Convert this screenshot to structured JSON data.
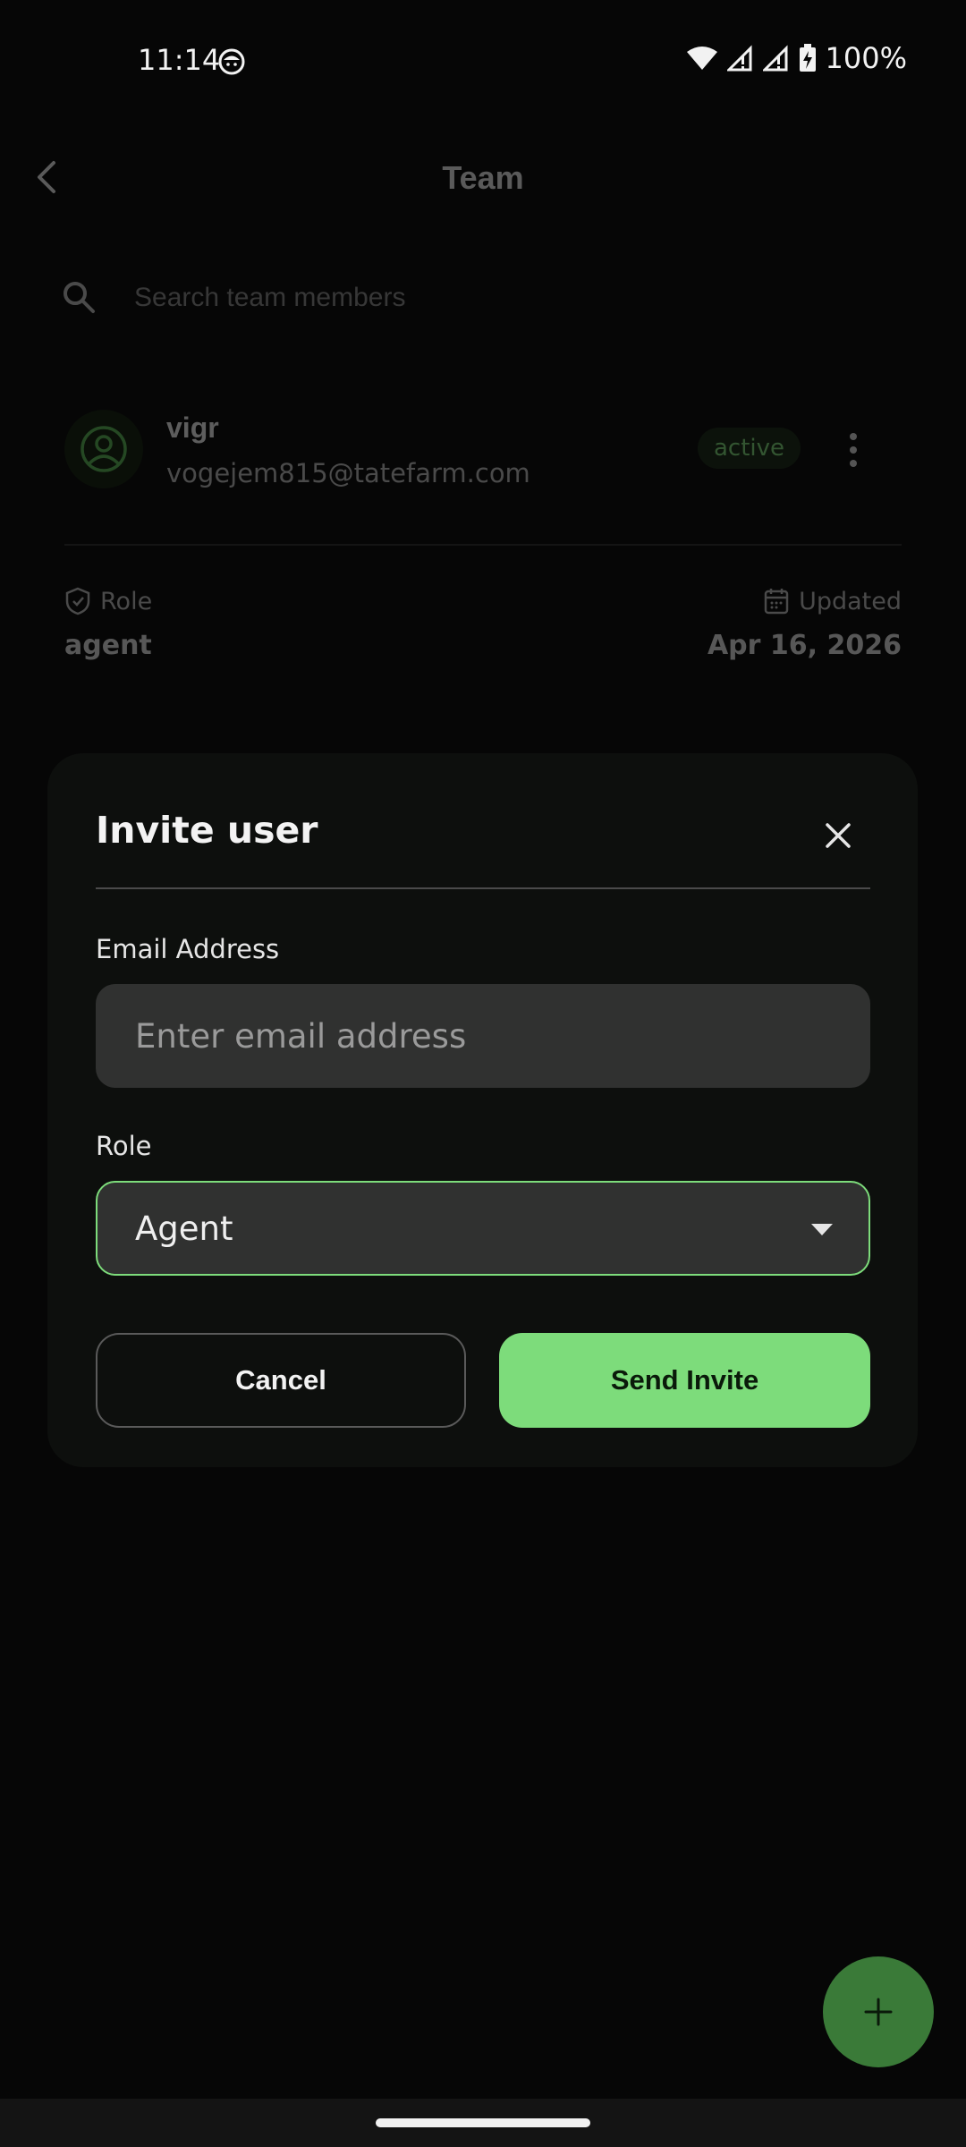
{
  "status_bar": {
    "time": "11:14",
    "battery": "100%"
  },
  "header": {
    "title": "Team",
    "back_icon": "chevron-left-icon"
  },
  "search": {
    "placeholder": "Search team members",
    "icon": "search-icon"
  },
  "member": {
    "name": "vigr",
    "email": "vogejem815@tatefarm.com",
    "status": "active",
    "role_label": "Role",
    "role_value": "agent",
    "updated_label": "Updated",
    "updated_value": "Apr 16, 2026"
  },
  "dialog": {
    "title": "Invite user",
    "email_label": "Email Address",
    "email_placeholder": "Enter email address",
    "email_value": "",
    "role_label": "Role",
    "role_selected": "Agent",
    "cancel_label": "Cancel",
    "send_label": "Send Invite"
  },
  "colors": {
    "accent": "#7ddc7b",
    "fab": "#3a7a38",
    "dialog_bg": "#0d0f0d",
    "field_bg": "#303130"
  }
}
